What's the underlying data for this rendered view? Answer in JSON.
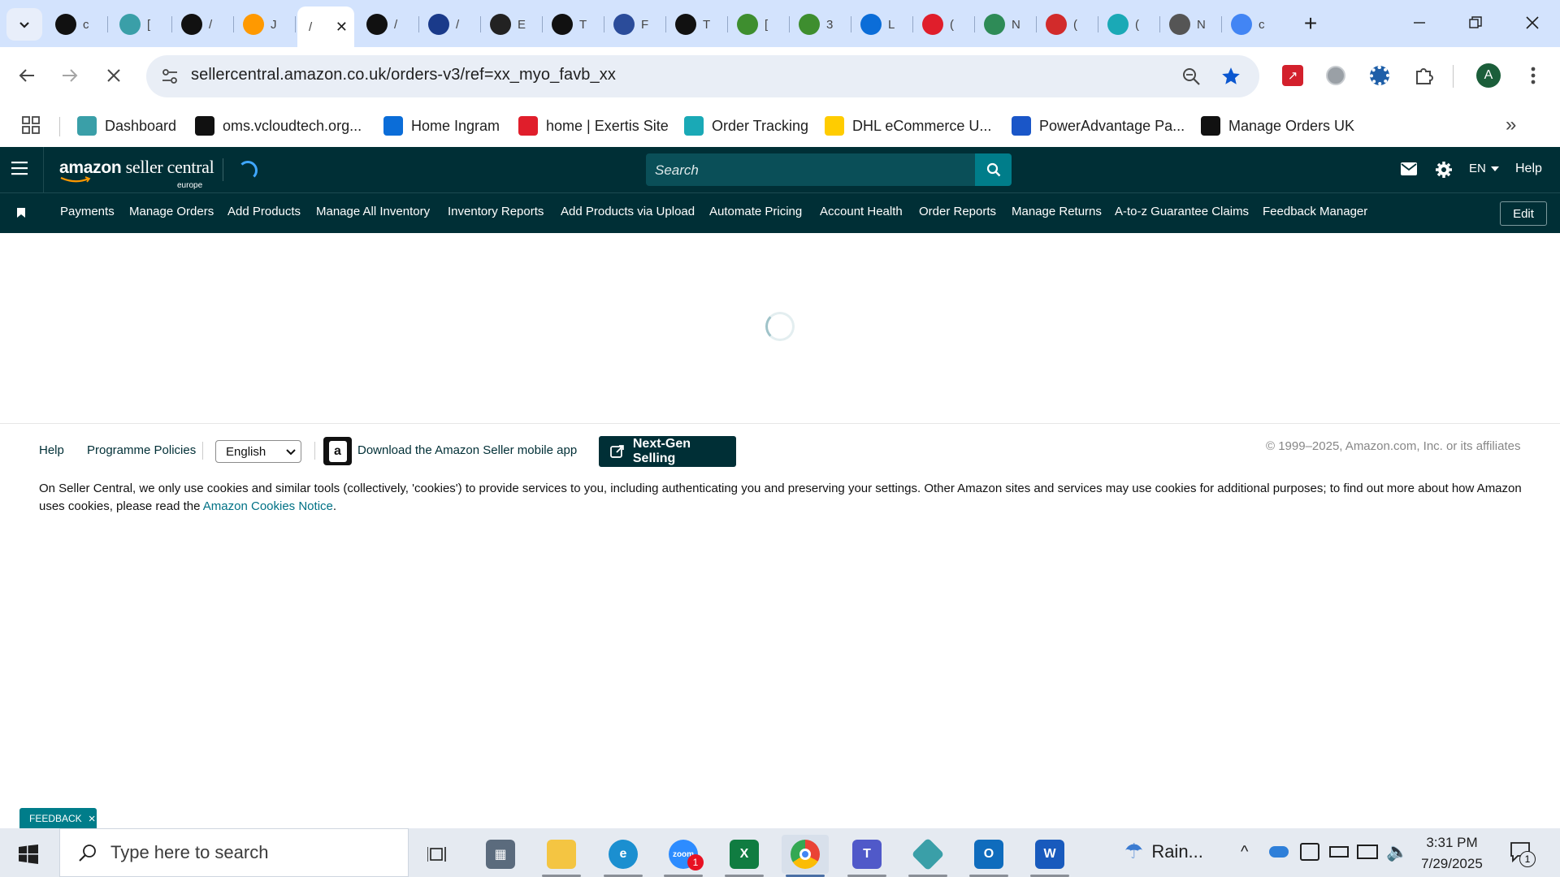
{
  "browser": {
    "tabs": [
      {
        "label": "c",
        "icon": "black-a-icon",
        "color": "#111111"
      },
      {
        "label": "[",
        "icon": "teal-hex-icon",
        "color": "#3a9fa8"
      },
      {
        "label": "/",
        "icon": "amazon-a-icon",
        "color": "#111111"
      },
      {
        "label": "J",
        "icon": "amazon-smile-icon",
        "color": "#ff9900"
      },
      {
        "label": "/",
        "icon": "amazon-a-icon",
        "color": "#111111"
      },
      {
        "label": "/",
        "icon": "arrow-play-icon",
        "color": "#1a3a8a"
      },
      {
        "label": "E",
        "icon": "openai-icon",
        "color": "#222222"
      },
      {
        "label": "T",
        "icon": "c-logo-icon",
        "color": "#111111"
      },
      {
        "label": "F",
        "icon": "box-icon",
        "color": "#2b4c9a"
      },
      {
        "label": "T",
        "icon": "c-logo-icon",
        "color": "#111111"
      },
      {
        "label": "[",
        "icon": "green-truck-icon",
        "color": "#3e8e2f"
      },
      {
        "label": "3",
        "icon": "green-truck-icon",
        "color": "#3e8e2f"
      },
      {
        "label": "L",
        "icon": "blue-flag-icon",
        "color": "#0b6dd8"
      },
      {
        "label": "(",
        "icon": "exertis-ex-icon",
        "color": "#e01e2b"
      },
      {
        "label": "N",
        "icon": "green-leaf-icon",
        "color": "#2e8b57"
      },
      {
        "label": "(",
        "icon": "shwe-icon",
        "color": "#d22b2b"
      },
      {
        "label": "(",
        "icon": "teal-c-icon",
        "color": "#1aa9b6"
      },
      {
        "label": "N",
        "icon": "chrome-gray-icon",
        "color": "#555555"
      },
      {
        "label": "c",
        "icon": "google-g-icon",
        "color": "#4285f4"
      }
    ],
    "active_tab": {
      "label": "/",
      "close": "✕"
    },
    "new_tab": "+",
    "url": "sellercentral.amazon.co.uk/orders-v3/ref=xx_myo_favb_xx",
    "profile_initial": "A",
    "bookmarks": [
      {
        "label": "Dashboard",
        "icon": "teal-hex-icon",
        "color": "#3a9fa8"
      },
      {
        "label": "oms.vcloudtech.org...",
        "icon": "black-a-icon",
        "color": "#111111"
      },
      {
        "label": "Home Ingram",
        "icon": "ingram-flag-icon",
        "color": "#0b6dd8"
      },
      {
        "label": "home | Exertis Site",
        "icon": "exertis-ex-icon",
        "color": "#e01e2b"
      },
      {
        "label": "Order Tracking",
        "icon": "teal-c-icon",
        "color": "#1aa9b6"
      },
      {
        "label": "DHL eCommerce U...",
        "icon": "dhl-icon",
        "color": "#ffcc00"
      },
      {
        "label": "PowerAdvantage Pa...",
        "icon": "poweradvantage-icon",
        "color": "#1a56c8"
      },
      {
        "label": "Manage Orders UK",
        "icon": "amazon-a-icon",
        "color": "#111111"
      }
    ]
  },
  "seller_central": {
    "logo_main": "amazon",
    "logo_sub": "seller central",
    "logo_region": "europe",
    "search_placeholder": "Search",
    "lang": "EN",
    "help": "Help",
    "nav_items": [
      "Payments",
      "Manage Orders",
      "Add Products",
      "Manage All Inventory",
      "Inventory Reports",
      "Add Products via Upload",
      "Automate Pricing",
      "Account Health",
      "Order Reports",
      "Manage Returns",
      "A-to-z Guarantee Claims",
      "Feedback Manager"
    ],
    "edit_label": "Edit",
    "brand_color": "#002f36",
    "accent_color": "#007d8a"
  },
  "footer": {
    "help": "Help",
    "policies": "Programme Policies",
    "language": "English",
    "app_download": "Download the Amazon Seller mobile app",
    "next_gen": "Next-Gen Selling",
    "copyright": "© 1999–2025, Amazon.com, Inc. or its affiliates",
    "cookie_text": "On Seller Central, we only use cookies and similar tools (collectively, 'cookies') to provide services to you, including authenticating you and preserving your settings. Other Amazon sites and services may use cookies for additional purposes; to find out more about how Amazon uses cookies, please read the ",
    "cookie_link": "Amazon Cookies Notice",
    "cookie_end": "."
  },
  "feedback": {
    "label": "FEEDBACK",
    "close": "×"
  },
  "taskbar": {
    "search_placeholder": "Type here to search",
    "weather": "Rain...",
    "time": "3:31 PM",
    "date": "7/29/2025",
    "notification_count": "1",
    "zoom_badge": "1"
  }
}
